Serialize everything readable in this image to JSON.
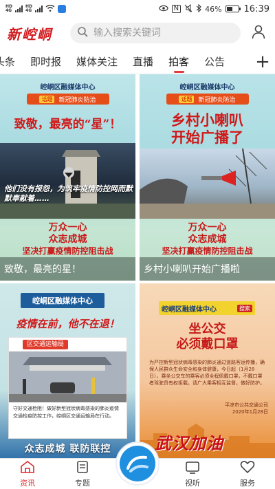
{
  "statusbar": {
    "left": [
      "HD 4G",
      "HD 4G"
    ],
    "percent": "46%",
    "time": "16:39"
  },
  "header": {
    "logo": "新崆峒",
    "search_placeholder": "输入搜索关键词",
    "user_icon": "user-icon"
  },
  "tabs": {
    "items": [
      {
        "label": "头条"
      },
      {
        "label": "即时报"
      },
      {
        "label": "媒体关注"
      },
      {
        "label": "直播"
      },
      {
        "label": "拍客",
        "active": true
      },
      {
        "label": "公告"
      }
    ],
    "add_label": "+"
  },
  "cards": [
    {
      "header": "崆峒区融媒体中心",
      "pill_tag": "话题",
      "pill_text": "新冠肺炎防治",
      "headline": "致敬，最亮的“星”！",
      "photo_text": "他们没有报怨，为筑牢疫情防控网而默默奉献着……",
      "slogan": [
        "万众一心",
        "众志成城",
        "坚决打赢疫情防控阻击战"
      ],
      "caption": "致敬，最亮的星！"
    },
    {
      "header": "崆峒区融媒体中心",
      "pill_tag": "话题",
      "pill_text": "新冠肺炎防治",
      "headline": [
        "乡村小喇叭",
        "开始广播了"
      ],
      "slogan": [
        "万众一心",
        "众志成城",
        "坚决打赢疫情防控阻击战"
      ],
      "caption": "乡村小喇叭开始广播啦"
    },
    {
      "header": "崆峒区融媒体中心",
      "headline": "疫情在前，他不在退！",
      "section": "区交通运输局",
      "body": "守好交通检阻！做好新型冠状病毒感染的肺炎疫情交通检疫防控工作，崆峒区交通运输局在行动。",
      "slogan": "众志成城  联防联控"
    },
    {
      "header": "崆峒区融媒体中心",
      "header_tag": "搜索",
      "headline": [
        "坐公交",
        "必须戴口罩"
      ],
      "body": "为严控新型冠状病毒感染的肺炎通过道路客运传播，确保人民群众生命安全和身体健康，今日起（1月28日），乘坐公交车的乘客必须全程佩戴口罩，不戴口罩者驾驶员有权拒载。请广大乘客相互监督，做好防护。",
      "signature": [
        "平凉市公共交通公司",
        "2020年1月28日"
      ],
      "brush": "武汉加油"
    }
  ],
  "bottomnav": {
    "items": [
      {
        "label": "资讯",
        "icon": "home-icon",
        "active": true
      },
      {
        "label": "专题",
        "icon": "document-icon"
      },
      {
        "label": "",
        "icon": "center-logo-icon"
      },
      {
        "label": "视听",
        "icon": "tv-icon"
      },
      {
        "label": "服务",
        "icon": "heart-icon"
      }
    ]
  },
  "colors": {
    "accent": "#d82c2c",
    "brand_blue": "#1f8fe0"
  }
}
